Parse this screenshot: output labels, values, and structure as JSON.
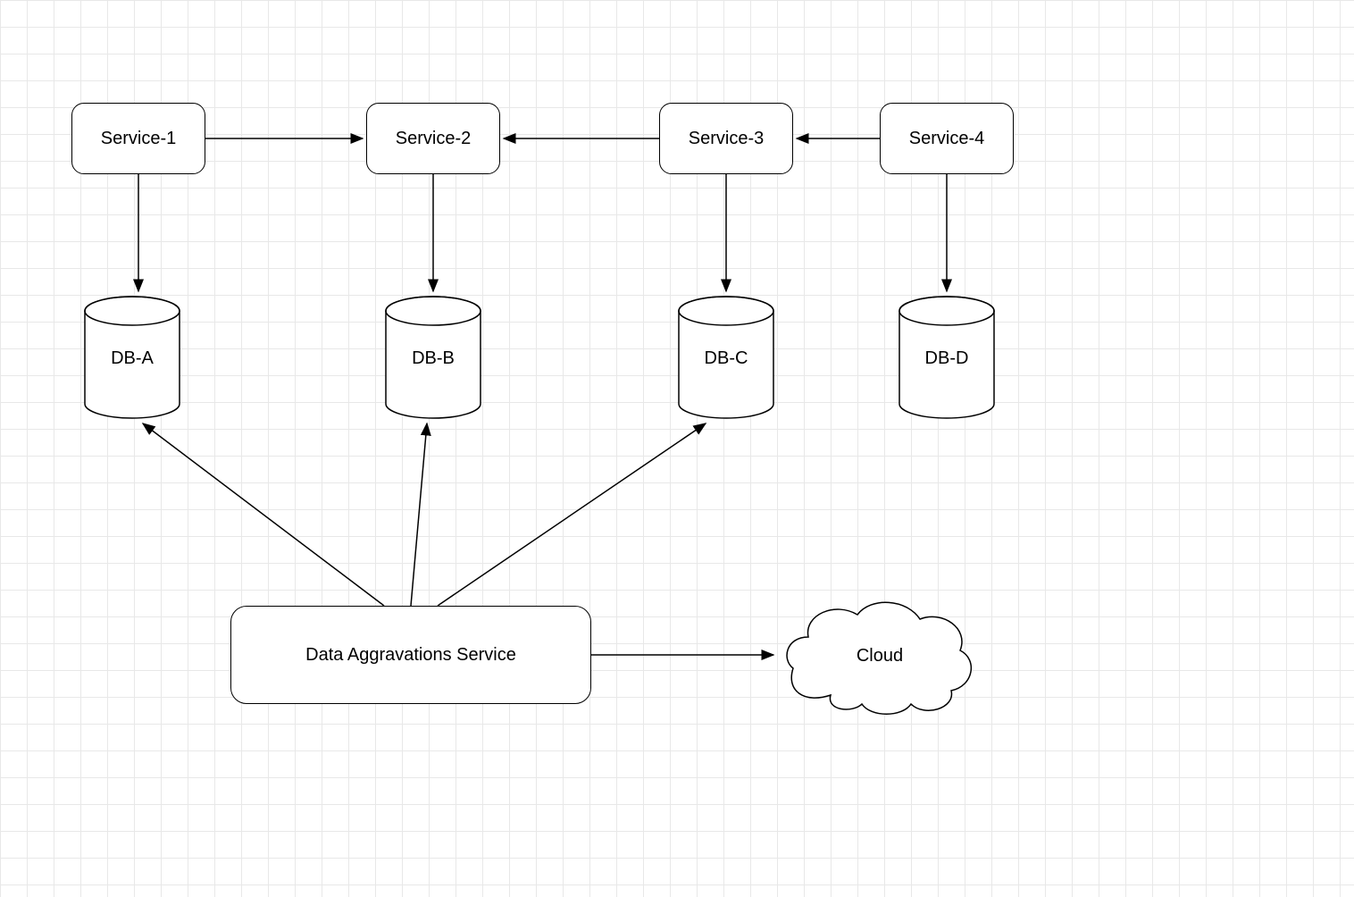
{
  "nodes": {
    "service1": {
      "label": "Service-1"
    },
    "service2": {
      "label": "Service-2"
    },
    "service3": {
      "label": "Service-3"
    },
    "service4": {
      "label": "Service-4"
    },
    "dbA": {
      "label": "DB-A"
    },
    "dbB": {
      "label": "DB-B"
    },
    "dbC": {
      "label": "DB-C"
    },
    "dbD": {
      "label": "DB-D"
    },
    "aggregator": {
      "label": "Data Aggravations Service"
    },
    "cloud": {
      "label": "Cloud"
    }
  },
  "edges": [
    {
      "from": "service1",
      "to": "service2"
    },
    {
      "from": "service3",
      "to": "service2"
    },
    {
      "from": "service4",
      "to": "service3"
    },
    {
      "from": "service1",
      "to": "dbA"
    },
    {
      "from": "service2",
      "to": "dbB"
    },
    {
      "from": "service3",
      "to": "dbC"
    },
    {
      "from": "service4",
      "to": "dbD"
    },
    {
      "from": "aggregator",
      "to": "dbA"
    },
    {
      "from": "aggregator",
      "to": "dbB"
    },
    {
      "from": "aggregator",
      "to": "dbC"
    },
    {
      "from": "aggregator",
      "to": "cloud"
    }
  ]
}
